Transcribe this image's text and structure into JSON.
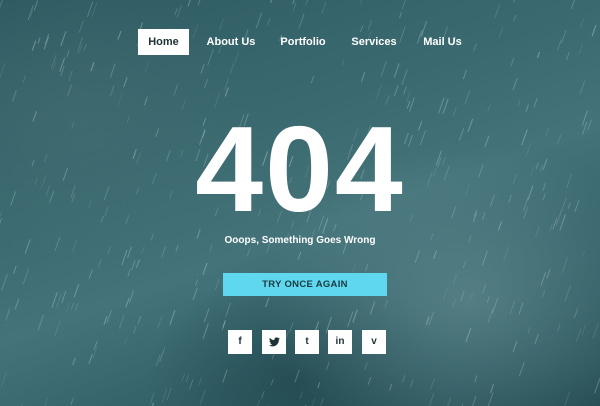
{
  "nav": {
    "items": [
      {
        "label": "Home",
        "active": true
      },
      {
        "label": "About Us",
        "active": false
      },
      {
        "label": "Portfolio",
        "active": false
      },
      {
        "label": "Services",
        "active": false
      },
      {
        "label": "Mail Us",
        "active": false
      }
    ]
  },
  "error": {
    "code": "404",
    "message": "Ooops, Something Goes Wrong",
    "button_label": "TRY ONCE AGAIN"
  },
  "social": {
    "facebook_glyph": "f",
    "tumblr_glyph": "t",
    "linkedin_glyph": "in",
    "vimeo_glyph": "v",
    "icons": [
      "facebook-icon",
      "twitter-icon",
      "tumblr-icon",
      "linkedin-icon",
      "vimeo-icon"
    ]
  },
  "colors": {
    "background": "#3a6a70",
    "button_accent": "#5fd7ee",
    "text": "#ffffff"
  }
}
